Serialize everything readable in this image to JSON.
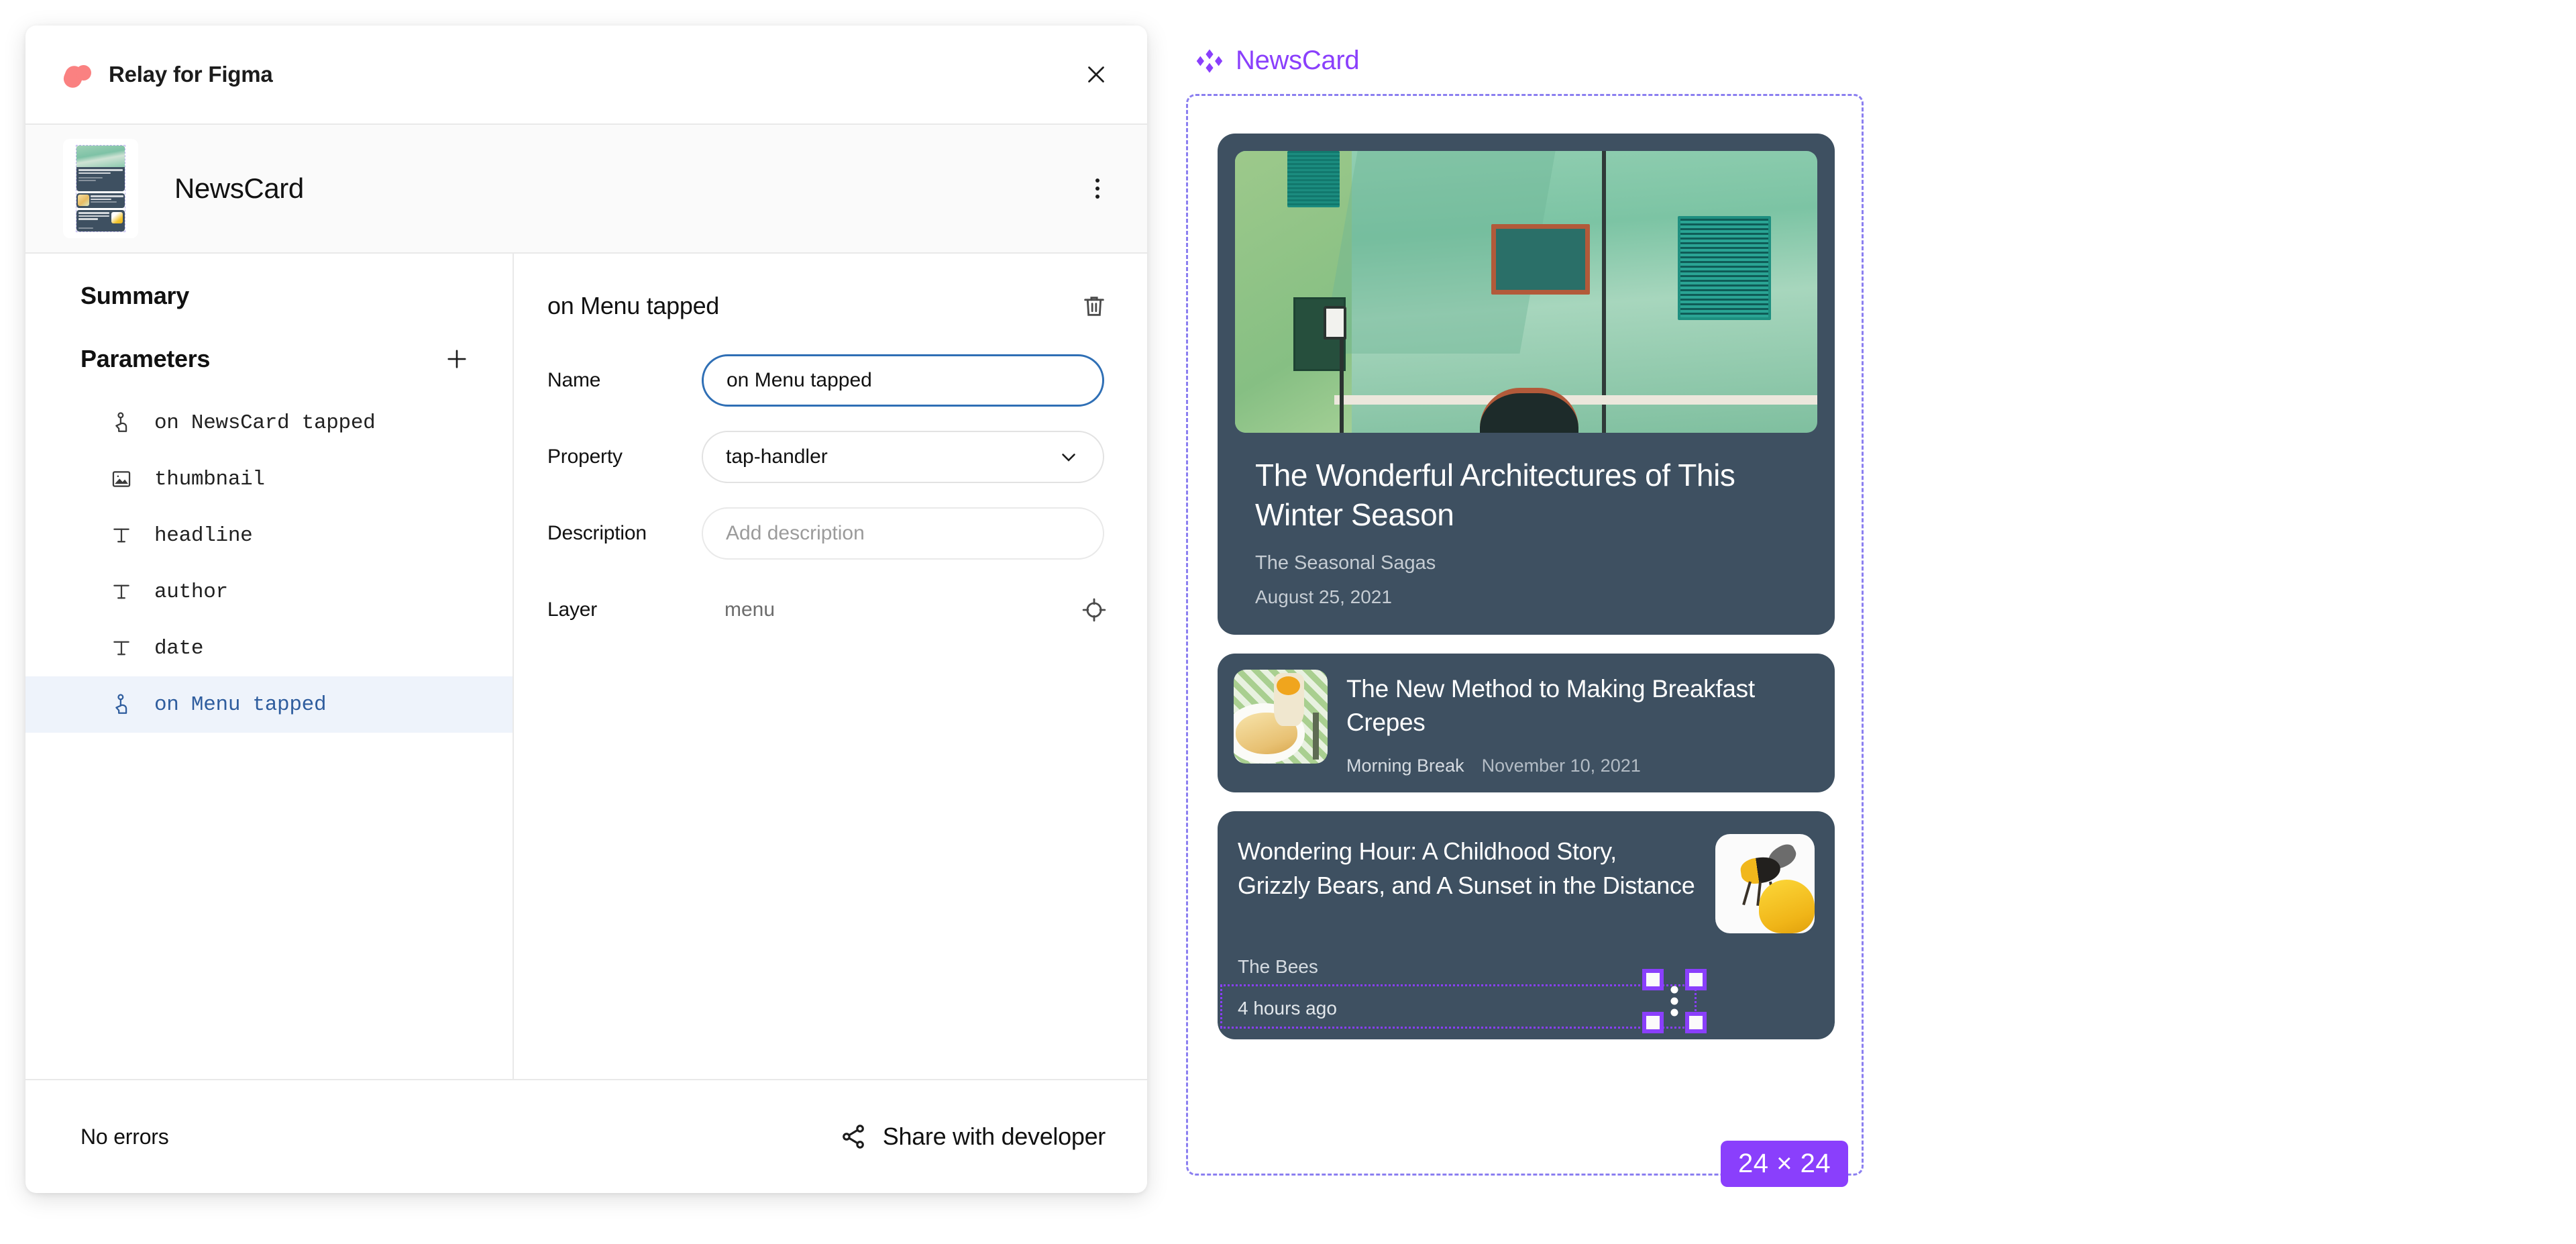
{
  "panel": {
    "title": "Relay for Figma",
    "logo_icon": "relay-logo-icon",
    "close_icon": "close-icon",
    "accent_blue": "#2f6fb5",
    "selected_row_bg": "#eef3fb",
    "logo_color": "#fa8181"
  },
  "component_header": {
    "name": "NewsCard",
    "thumbnail_icon": "component-thumbnail",
    "overflow_menu_icon": "more-vertical-icon"
  },
  "left": {
    "summary_heading": "Summary",
    "parameters_heading": "Parameters",
    "add_icon": "plus-icon",
    "parameters": [
      {
        "label": "on NewsCard tapped",
        "icon": "tap-handler-icon",
        "selected": false
      },
      {
        "label": "thumbnail",
        "icon": "image-icon",
        "selected": false
      },
      {
        "label": "headline",
        "icon": "text-icon",
        "selected": false
      },
      {
        "label": "author",
        "icon": "text-icon",
        "selected": false
      },
      {
        "label": "date",
        "icon": "text-icon",
        "selected": false
      },
      {
        "label": "on Menu tapped",
        "icon": "tap-handler-icon",
        "selected": true
      }
    ]
  },
  "detail": {
    "title": "on Menu tapped",
    "delete_icon": "trash-icon",
    "name_label": "Name",
    "name_value": "on Menu tapped",
    "property_label": "Property",
    "property_value": "tap-handler",
    "property_chevron_icon": "chevron-down-icon",
    "description_label": "Description",
    "description_value": "",
    "description_placeholder": "Add description",
    "layer_label": "Layer",
    "layer_value": "menu",
    "locate_icon": "crosshair-target-icon"
  },
  "footer": {
    "error_status": "No errors",
    "share_icon": "share-nodes-icon",
    "share_label": "Share with developer"
  },
  "canvas": {
    "frame_label": "NewsCard",
    "frame_icon": "figma-component-icon",
    "frame_color": "#8b7ff0",
    "selection_color": "#8a3ffc",
    "size_badge": "24 × 24",
    "cards": [
      {
        "type": "hero",
        "headline": "The Wonderful Architectures of This Winter Season",
        "author": "The Seasonal Sagas",
        "date": "August 25, 2021",
        "image_icon": "green-building-photo"
      },
      {
        "type": "row",
        "headline": "The New Method to Making Breakfast Crepes",
        "author": "Morning Break",
        "date": "November 10, 2021",
        "image_icon": "breakfast-crepes-photo"
      },
      {
        "type": "featured",
        "headline": "Wondering Hour: A Childhood Story, Grizzly Bears, and A Sunset in the Distance",
        "author": "The Bees",
        "date": "4 hours ago",
        "image_icon": "bee-honey-photo",
        "menu_icon": "more-vertical-icon"
      }
    ]
  }
}
